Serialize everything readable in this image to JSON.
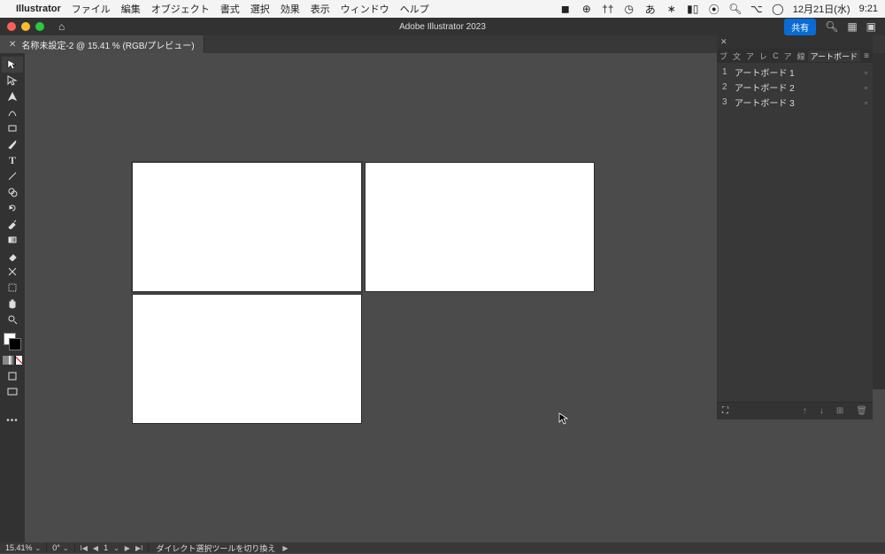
{
  "menubar": {
    "app": "Illustrator",
    "items": [
      "ファイル",
      "編集",
      "オブジェクト",
      "書式",
      "選択",
      "効果",
      "表示",
      "ウィンドウ",
      "ヘルプ"
    ],
    "status_date": "12月21日(水)",
    "status_time": "9:21"
  },
  "titlebar": {
    "title": "Adobe Illustrator 2023",
    "share_label": "共有"
  },
  "document": {
    "tab_label": "名称未設定-2 @ 15.41 % (RGB/プレビュー)"
  },
  "artboards_panel": {
    "tabs_inactive": [
      "ブ",
      "文",
      "ア",
      "レ",
      "C",
      "ア",
      "線"
    ],
    "active_tab": "アートボード",
    "items": [
      {
        "index": "1",
        "name": "アートボード 1"
      },
      {
        "index": "2",
        "name": "アートボード 2"
      },
      {
        "index": "3",
        "name": "アートボード 3"
      }
    ]
  },
  "statusbar": {
    "zoom": "15.41%",
    "rotation": "0°",
    "page_current": "1",
    "hint": "ダイレクト選択ツールを切り換え"
  }
}
